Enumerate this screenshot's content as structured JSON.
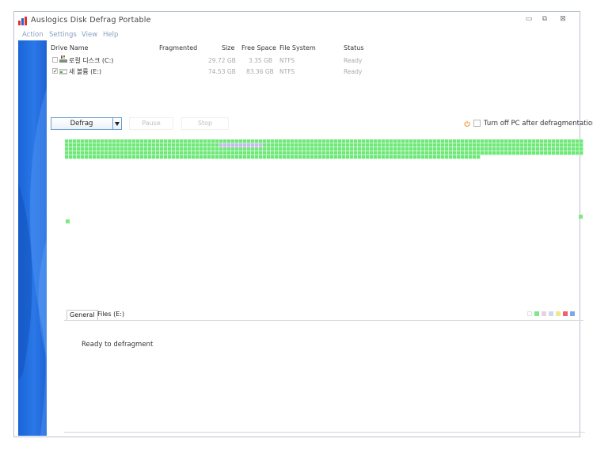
{
  "window": {
    "title": "Auslogics Disk Defrag Portable",
    "controls": {
      "minimize": "▭",
      "restore": "⧉",
      "close": "⊠"
    }
  },
  "menu": [
    "Action",
    "Settings",
    "View",
    "Help"
  ],
  "drive_table": {
    "columns": [
      "Drive Name",
      "Fragmented",
      "Size",
      "Free Space",
      "File System",
      "Status"
    ],
    "rows": [
      {
        "checked": false,
        "name": "로컬 디스크 (C:)",
        "fragmented": "",
        "size": "29.72 GB",
        "free_space": "3.35 GB",
        "file_system": "NTFS",
        "status": "Ready"
      },
      {
        "checked": true,
        "name": "새 볼륨 (E:)",
        "fragmented": "",
        "size": "74.53 GB",
        "free_space": "83.36 GB",
        "file_system": "NTFS",
        "status": "Ready"
      }
    ]
  },
  "actions": {
    "defrag_label": "Defrag",
    "pause_label": "Pause",
    "stop_label": "Stop",
    "turn_off_label": "Turn off PC after defragmentation",
    "turn_off_checked": false
  },
  "cluster_map": {
    "used_color": "#6ee878",
    "highlight_color": "#c8b8f0",
    "used_fraction": 0.8
  },
  "tabs": [
    {
      "label": "General",
      "active": true
    },
    {
      "label": "Files (E:)",
      "active": false
    }
  ],
  "legend_colors": [
    "#ffffff",
    "#7ee886",
    "#e8d0e8",
    "#d0d8f0",
    "#f0e890",
    "#f06070",
    "#7fa8e8"
  ],
  "status_message": "Ready to defragment",
  "icons": {
    "app": "app-chart-icon",
    "drive": "drive-icon",
    "power": "power-icon",
    "dropdown": "chevron-down-icon"
  }
}
